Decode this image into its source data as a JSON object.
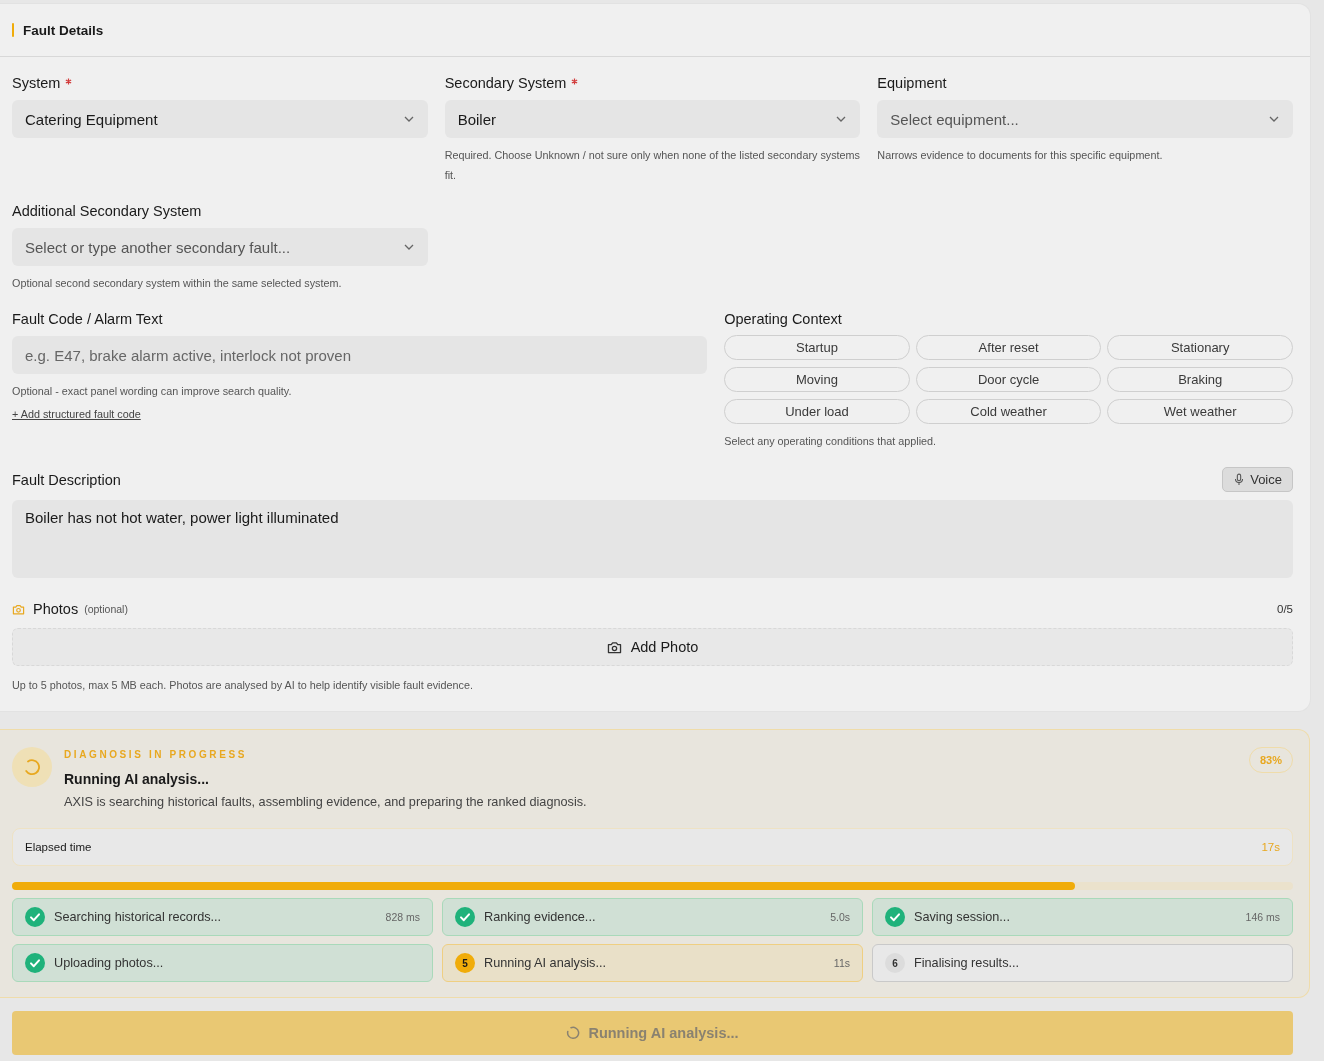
{
  "fault_details": {
    "title": "Fault Details",
    "selects": [
      {
        "label": "System",
        "required": true,
        "value": "Catering Equipment"
      },
      {
        "label": "Secondary System",
        "required": true,
        "value": "Boiler",
        "help": "Required. Choose Unknown / not sure only when none of the listed secondary systems fit."
      },
      {
        "label": "Equipment",
        "required": false,
        "placeholder": "Select equipment...",
        "help": "Narrows evidence to documents for this specific equipment."
      },
      {
        "label": "Additional Secondary System",
        "required": false,
        "placeholder": "Select or type another secondary fault...",
        "help": "Optional second secondary system within the same selected system."
      }
    ],
    "fault_code": {
      "label": "Fault Code / Alarm Text",
      "placeholder": "e.g. E47, brake alarm active, interlock not proven",
      "help": "Optional - exact panel wording can improve search quality.",
      "link": "+ Add structured fault code"
    },
    "operating_context": {
      "label": "Operating Context",
      "options": [
        {
          "label": "Startup",
          "selected": false
        },
        {
          "label": "After reset",
          "selected": false
        },
        {
          "label": "Stationary",
          "selected": false
        },
        {
          "label": "Moving",
          "selected": false
        },
        {
          "label": "Door cycle",
          "selected": false
        },
        {
          "label": "Braking",
          "selected": false
        },
        {
          "label": "Under load",
          "selected": false
        },
        {
          "label": "Cold weather",
          "selected": false
        },
        {
          "label": "Wet weather",
          "selected": false
        }
      ],
      "help": "Select any operating conditions that applied."
    },
    "description": {
      "label": "Fault Description",
      "voice_button": "Voice",
      "value": "Boiler has not hot water, power light illuminated"
    },
    "photos": {
      "label": "Photos",
      "note": "(optional)",
      "count": "0/5",
      "add_button": "Add Photo",
      "help": "Up to 5 photos, max 5 MB each. Photos are analysed by AI to help identify visible fault evidence."
    }
  },
  "diagnosis": {
    "eyebrow": "DIAGNOSIS IN PROGRESS",
    "title": "Running AI analysis...",
    "description": "AXIS is searching historical faults, assembling evidence, and preparing the ranked diagnosis.",
    "percent": "83%",
    "elapsed": {
      "label": "Elapsed time",
      "value": "17s"
    },
    "progress": {
      "level": 0.83
    },
    "steps": [
      {
        "kind": "done",
        "label": "Searching historical records...",
        "time": "828 ms"
      },
      {
        "kind": "done",
        "label": "Ranking evidence...",
        "time": "5.0s"
      },
      {
        "kind": "done",
        "label": "Saving session...",
        "time": "146 ms"
      },
      {
        "kind": "done",
        "label": "Uploading photos..."
      },
      {
        "kind": "active",
        "number": "5",
        "label": "Running AI analysis...",
        "time": "11s"
      },
      {
        "kind": "pending",
        "number": "6",
        "label": "Finalising results..."
      }
    ]
  },
  "submit_button": {
    "label": "Running AI analysis...",
    "disabled": true
  }
}
